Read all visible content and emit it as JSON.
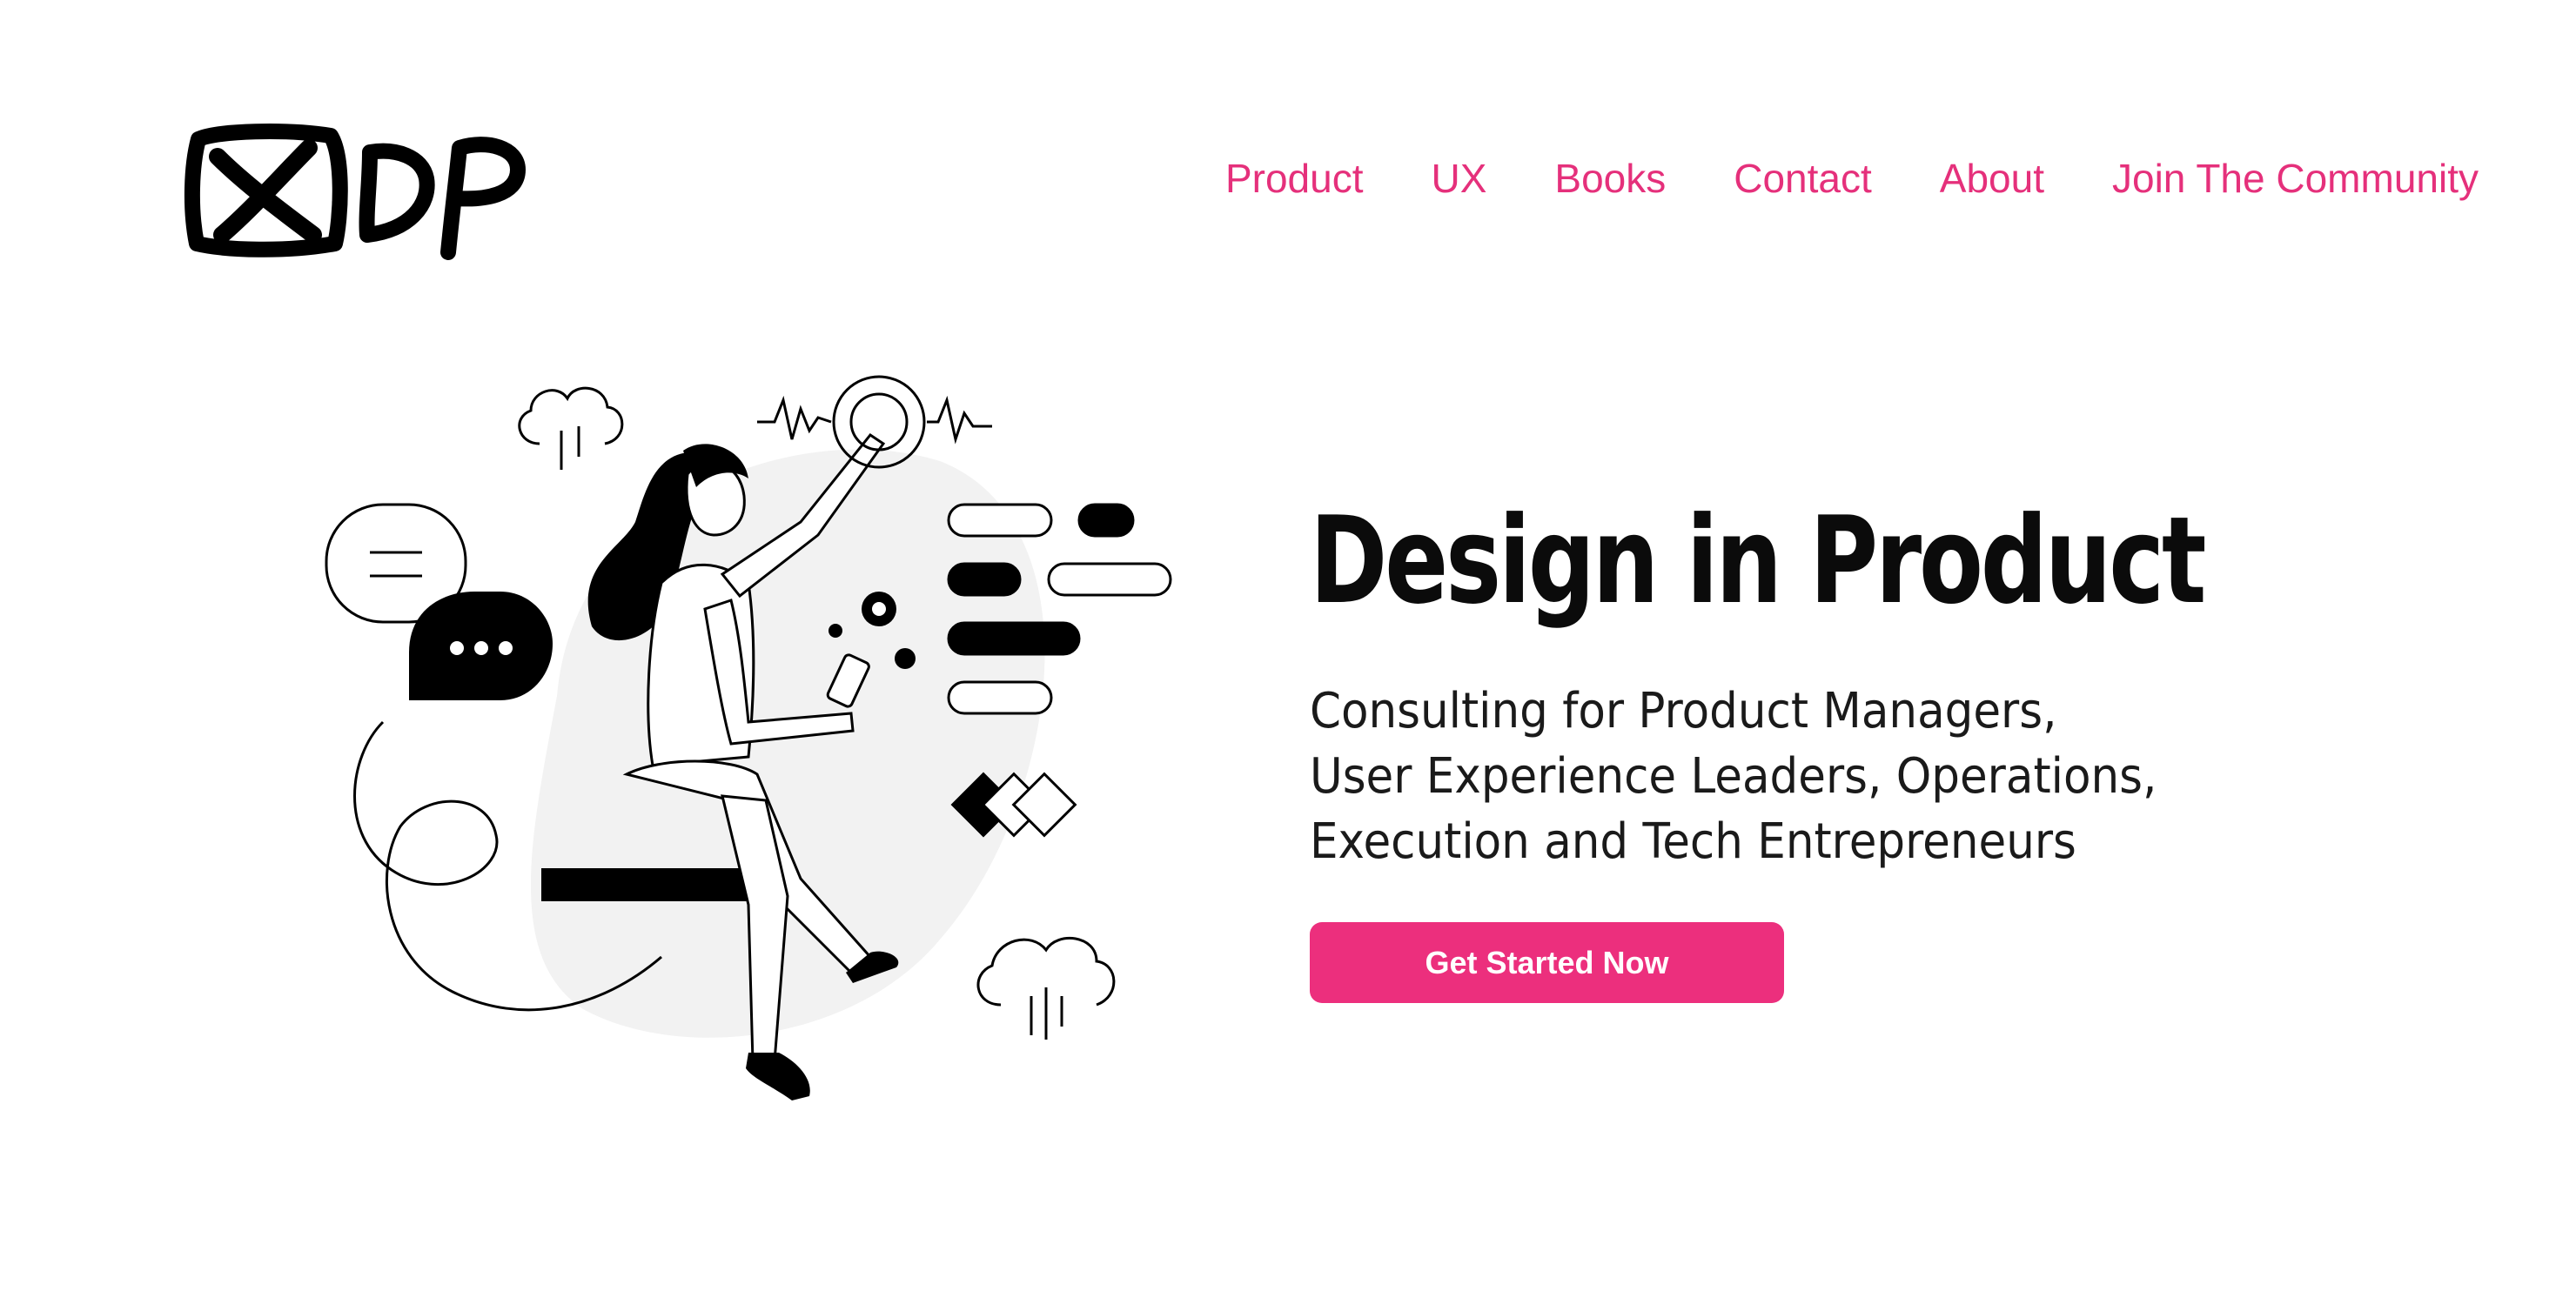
{
  "header": {
    "logo_alt": "DP",
    "nav": [
      {
        "label": "Product"
      },
      {
        "label": "UX"
      },
      {
        "label": "Books"
      },
      {
        "label": "Contact"
      },
      {
        "label": "About"
      },
      {
        "label": "Join The Community"
      }
    ]
  },
  "hero": {
    "title": "Design in Product",
    "subtitle_lines": [
      "Consulting for Product Managers,",
      "User Experience Leaders, Operations,",
      "Execution and Tech Entrepreneurs"
    ],
    "cta_label": "Get Started Now"
  },
  "colors": {
    "accent": "#e5307b",
    "button": "#ec2f7d",
    "text": "#111111",
    "background": "#ffffff",
    "illustration_fill": "#f2f2f2"
  },
  "icons": [
    "dp-logo-icon",
    "cloud-icon",
    "chat-bubble-icon",
    "touch-target-icon",
    "diamond-shapes-icon"
  ]
}
